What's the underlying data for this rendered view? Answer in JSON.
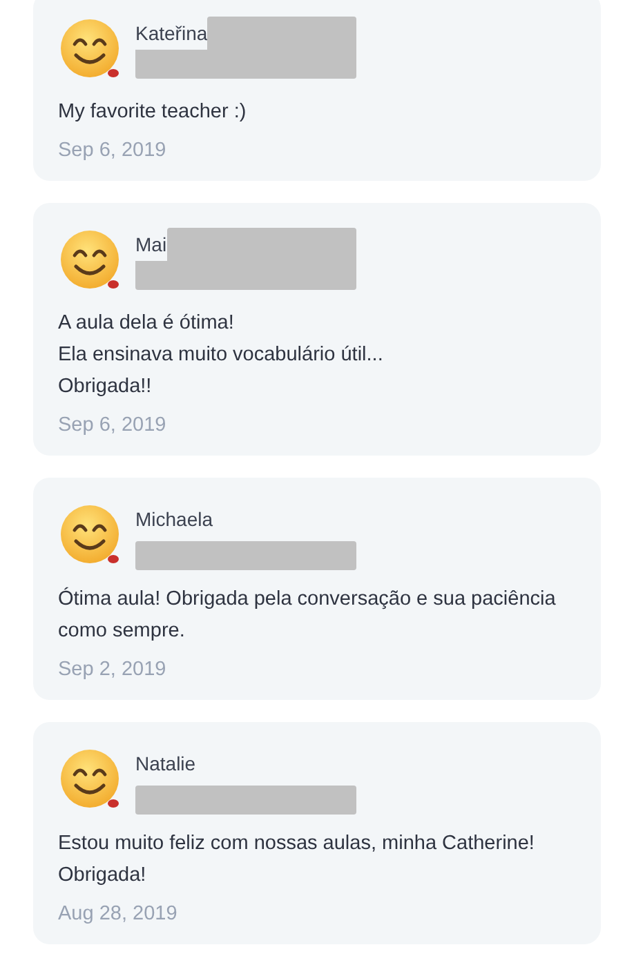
{
  "reviews": [
    {
      "name": "Kateřina",
      "kind": "block",
      "lines": [
        "My favorite teacher :)"
      ],
      "date": "Sep 6, 2019"
    },
    {
      "name": "Mai",
      "kind": "block",
      "lines": [
        "A aula dela é ótima!",
        "Ela ensinava muito vocabulário útil...",
        "Obrigada!!"
      ],
      "date": "Sep 6, 2019"
    },
    {
      "name": "Michaela",
      "kind": "bar",
      "lines": [
        "Ótima aula! Obrigada pela conversação e sua paciência como sempre."
      ],
      "date": "Sep 2, 2019"
    },
    {
      "name": "Natalie",
      "kind": "bar",
      "lines": [
        "Estou muito feliz com nossas aulas, minha Catherine!",
        "Obrigada!"
      ],
      "date": "Aug 28, 2019"
    }
  ]
}
